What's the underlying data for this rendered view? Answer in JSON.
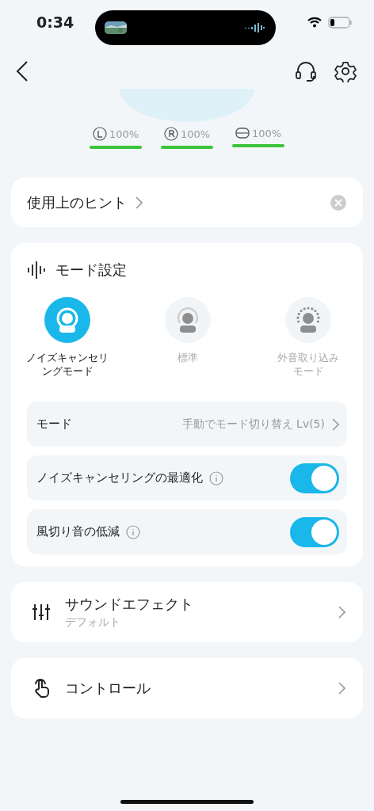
{
  "status_bar": {
    "time": "0:34"
  },
  "battery": [
    {
      "kind": "left",
      "reading": "100%",
      "level": 1
    },
    {
      "kind": "right",
      "reading": "100%",
      "level": 1
    },
    {
      "kind": "case",
      "reading": "100%",
      "level": 1
    }
  ],
  "hint": {
    "label": "使用上のヒント"
  },
  "mode_settings": {
    "title": "モード設定",
    "modes": [
      {
        "kind": "anc",
        "label": "ノイズキャンセリングモード",
        "selected": true
      },
      {
        "kind": "normal",
        "label": "標準",
        "selected": false
      },
      {
        "kind": "ambient",
        "label": "外音取り込みモード",
        "selected": false
      }
    ],
    "rows": [
      {
        "kind": "link",
        "label": "モード",
        "value": "手動でモード切り替え Lv(5)"
      },
      {
        "kind": "toggle",
        "label": "ノイズキャンセリングの最適化",
        "on": true
      },
      {
        "kind": "toggle",
        "label": "風切り音の低減",
        "on": true
      }
    ]
  },
  "menu": [
    {
      "kind": "equalizer",
      "title": "サウンドエフェクト",
      "subtitle": "デフォルト"
    },
    {
      "kind": "touch",
      "title": "コントロール"
    }
  ]
}
